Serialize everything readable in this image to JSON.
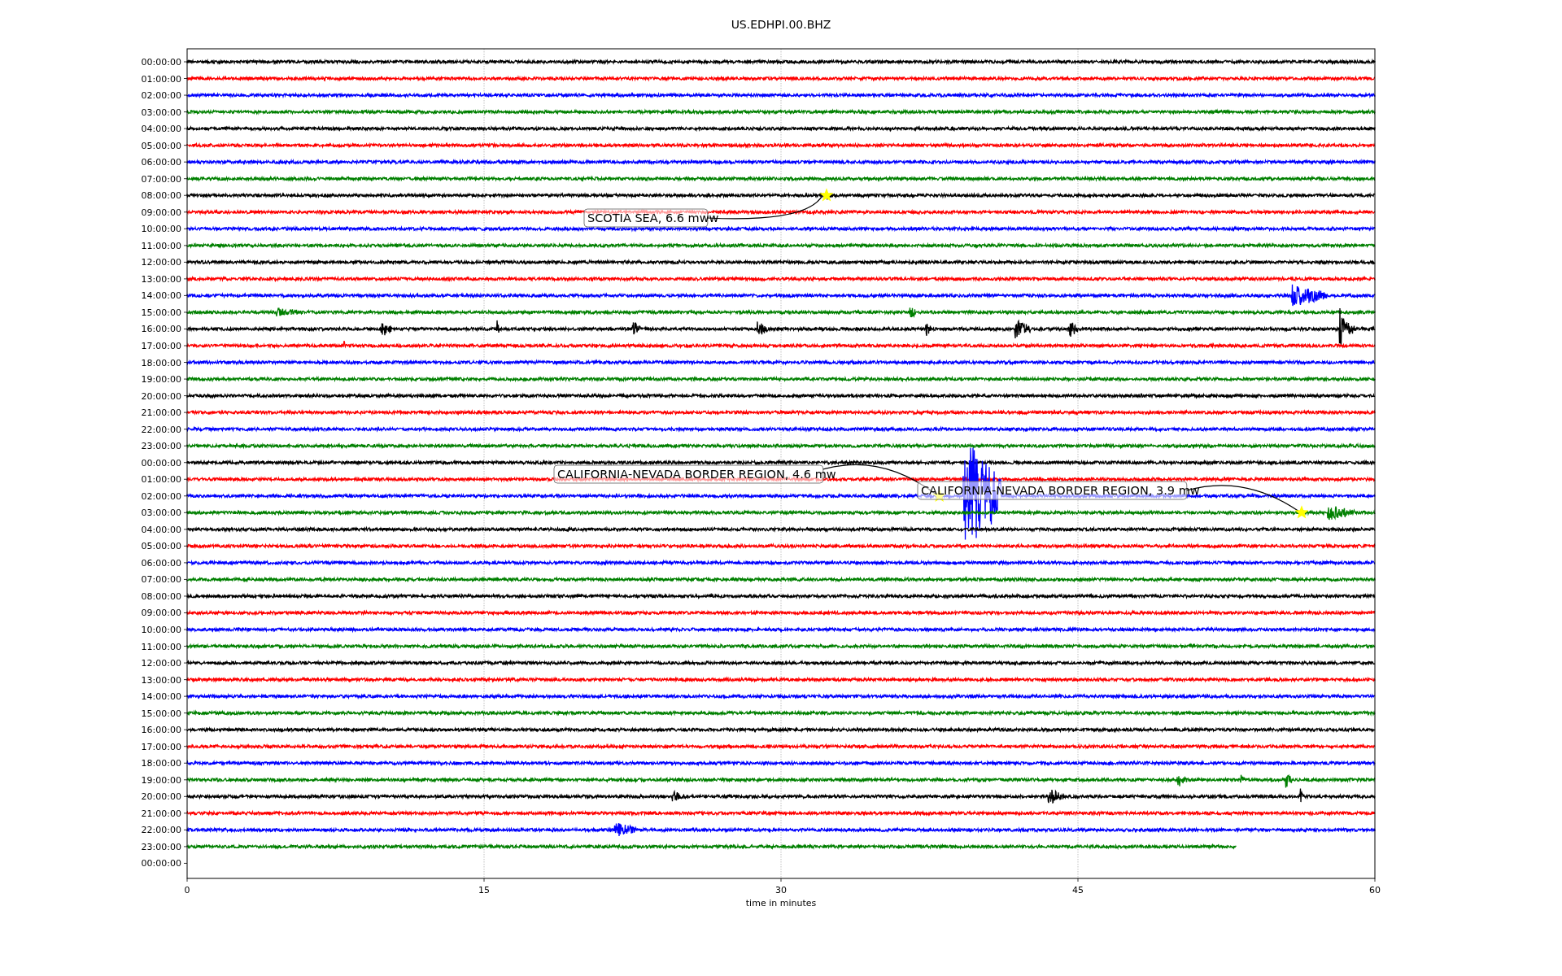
{
  "title": "US.EDHPI.00.BHZ",
  "rows": [
    {
      "label": "00:00:00",
      "color": "#000000"
    },
    {
      "label": "01:00:00",
      "color": "#ff0000"
    },
    {
      "label": "02:00:00",
      "color": "#0000ff"
    },
    {
      "label": "03:00:00",
      "color": "#008000"
    },
    {
      "label": "04:00:00",
      "color": "#000000"
    },
    {
      "label": "05:00:00",
      "color": "#ff0000"
    },
    {
      "label": "06:00:00",
      "color": "#0000ff"
    },
    {
      "label": "07:00:00",
      "color": "#008000"
    },
    {
      "label": "08:00:00",
      "color": "#000000"
    },
    {
      "label": "09:00:00",
      "color": "#ff0000"
    },
    {
      "label": "10:00:00",
      "color": "#0000ff"
    },
    {
      "label": "11:00:00",
      "color": "#008000"
    },
    {
      "label": "12:00:00",
      "color": "#000000"
    },
    {
      "label": "13:00:00",
      "color": "#ff0000"
    },
    {
      "label": "14:00:00",
      "color": "#0000ff"
    },
    {
      "label": "15:00:00",
      "color": "#008000"
    },
    {
      "label": "16:00:00",
      "color": "#000000"
    },
    {
      "label": "17:00:00",
      "color": "#ff0000"
    },
    {
      "label": "18:00:00",
      "color": "#0000ff"
    },
    {
      "label": "19:00:00",
      "color": "#008000"
    },
    {
      "label": "20:00:00",
      "color": "#000000"
    },
    {
      "label": "21:00:00",
      "color": "#ff0000"
    },
    {
      "label": "22:00:00",
      "color": "#0000ff"
    },
    {
      "label": "23:00:00",
      "color": "#008000"
    },
    {
      "label": "00:00:00",
      "color": "#000000"
    },
    {
      "label": "01:00:00",
      "color": "#ff0000"
    },
    {
      "label": "02:00:00",
      "color": "#0000ff"
    },
    {
      "label": "03:00:00",
      "color": "#008000"
    },
    {
      "label": "04:00:00",
      "color": "#000000"
    },
    {
      "label": "05:00:00",
      "color": "#ff0000"
    },
    {
      "label": "06:00:00",
      "color": "#0000ff"
    },
    {
      "label": "07:00:00",
      "color": "#008000"
    },
    {
      "label": "08:00:00",
      "color": "#000000"
    },
    {
      "label": "09:00:00",
      "color": "#ff0000"
    },
    {
      "label": "10:00:00",
      "color": "#0000ff"
    },
    {
      "label": "11:00:00",
      "color": "#008000"
    },
    {
      "label": "12:00:00",
      "color": "#000000"
    },
    {
      "label": "13:00:00",
      "color": "#ff0000"
    },
    {
      "label": "14:00:00",
      "color": "#0000ff"
    },
    {
      "label": "15:00:00",
      "color": "#008000"
    },
    {
      "label": "16:00:00",
      "color": "#000000"
    },
    {
      "label": "17:00:00",
      "color": "#ff0000"
    },
    {
      "label": "18:00:00",
      "color": "#0000ff"
    },
    {
      "label": "19:00:00",
      "color": "#008000"
    },
    {
      "label": "20:00:00",
      "color": "#000000"
    },
    {
      "label": "21:00:00",
      "color": "#ff0000"
    },
    {
      "label": "22:00:00",
      "color": "#0000ff"
    },
    {
      "label": "23:00:00",
      "color": "#008000"
    }
  ],
  "last_row_label": "00:00:00",
  "x_axis": {
    "ticks": [
      "0",
      "15",
      "30",
      "45",
      "60"
    ],
    "label": "time in minutes"
  },
  "annotations": [
    {
      "text": "SCOTIA SEA, 6.6 mww"
    },
    {
      "text": "CALIFORNIA-NEVADA BORDER REGION, 4.6 mw"
    },
    {
      "text": "CALIFORNIA-NEVADA BORDER REGION, 3.9 mw"
    }
  ]
}
